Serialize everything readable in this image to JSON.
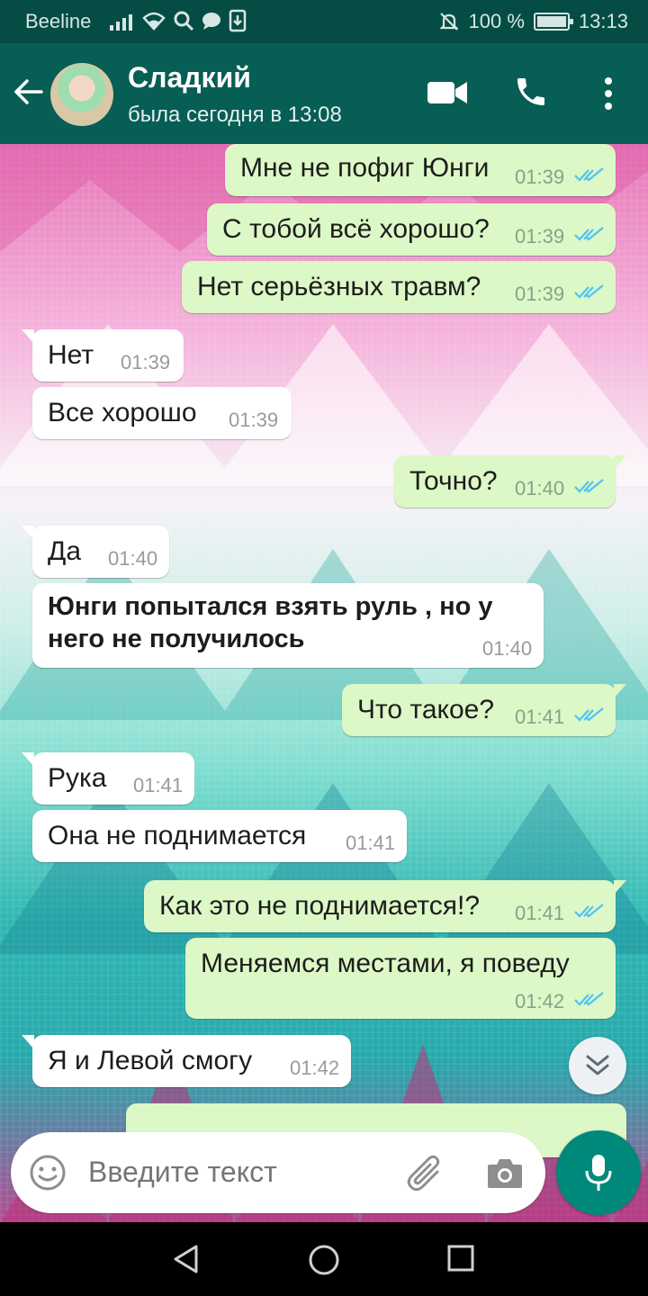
{
  "status_bar": {
    "carrier": "Beeline",
    "battery_percent": "100 %",
    "time": "13:13",
    "icons": [
      "signal-icon",
      "wifi-icon",
      "search-icon",
      "chat-icon",
      "download-icon",
      "mute-icon",
      "battery-icon"
    ]
  },
  "header": {
    "contact_name": "Сладкий",
    "last_seen": "была сегодня в 13:08",
    "icons": [
      "back-arrow-icon",
      "video-call-icon",
      "phone-icon",
      "more-vert-icon"
    ]
  },
  "messages": [
    {
      "dir": "out",
      "text": "Мне не пофиг Юнги",
      "time": "01:39",
      "ticks": "read"
    },
    {
      "dir": "out",
      "text": "С тобой всё хорошо?",
      "time": "01:39",
      "ticks": "read"
    },
    {
      "dir": "out",
      "text": "Нет серьёзных травм?",
      "time": "01:39",
      "ticks": "read"
    },
    {
      "dir": "in",
      "text": "Нет",
      "time": "01:39"
    },
    {
      "dir": "in",
      "text": "Все хорошо",
      "time": "01:39"
    },
    {
      "dir": "out",
      "text": "Точно?",
      "time": "01:40",
      "ticks": "read"
    },
    {
      "dir": "in",
      "text": "Да",
      "time": "01:40"
    },
    {
      "dir": "in",
      "text_line1": "Юнги попытался взять руль , но у",
      "text_line2": "него не получилось",
      "time": "01:40",
      "bold": true
    },
    {
      "dir": "out",
      "text": "Что такое?",
      "time": "01:41",
      "ticks": "read"
    },
    {
      "dir": "in",
      "text": "Рука",
      "time": "01:41"
    },
    {
      "dir": "in",
      "text": "Она не поднимается",
      "time": "01:41"
    },
    {
      "dir": "out",
      "text": "Как это не поднимается!?",
      "time": "01:41",
      "ticks": "read"
    },
    {
      "dir": "out",
      "text": "Меняемся местами, я поведу",
      "time": "01:42",
      "ticks": "read"
    },
    {
      "dir": "in",
      "text": "Я и Левой смогу",
      "time": "01:42"
    }
  ],
  "composer": {
    "placeholder": "Введите текст"
  },
  "colors": {
    "header": "#075e54",
    "status_bar": "#054d44",
    "outgoing_bubble": "#dcf8c6",
    "incoming_bubble": "#ffffff",
    "read_ticks": "#4fc3f7",
    "mic_button": "#00897b"
  }
}
